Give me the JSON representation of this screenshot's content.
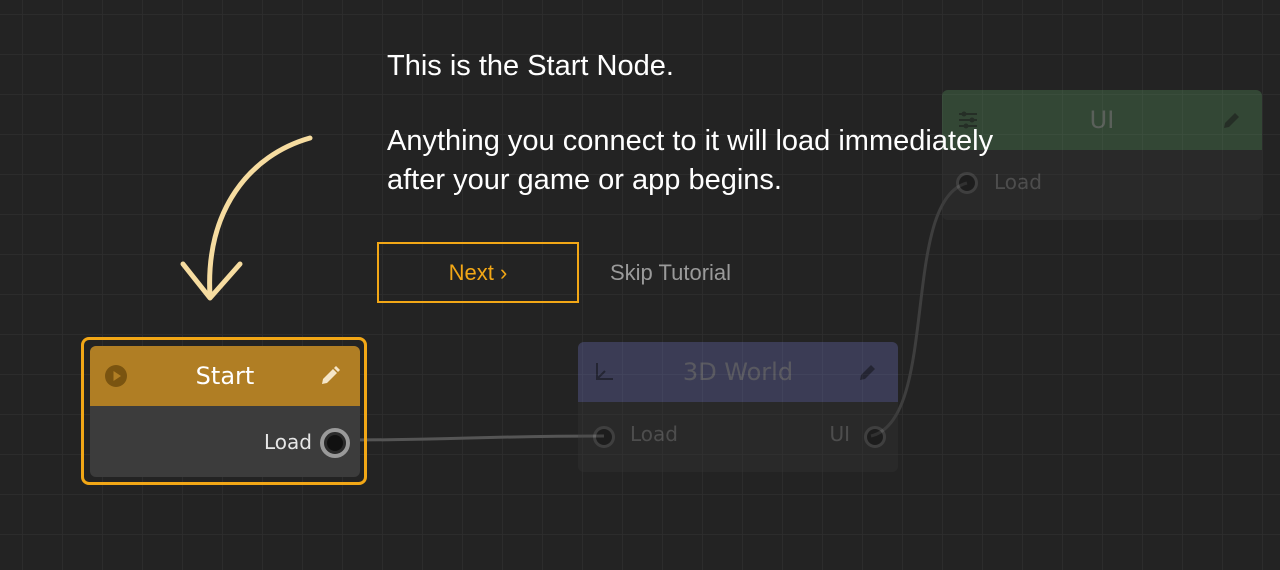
{
  "tutorial": {
    "line1": "This is the Start Node.",
    "line2": "Anything you connect to it will load immediately",
    "line3": "after your game or app begins.",
    "next_label": "Next ›",
    "skip_label": "Skip Tutorial"
  },
  "nodes": {
    "start": {
      "title": "Start",
      "output_label": "Load",
      "icon": "play-icon",
      "edit_icon": "pencil-icon",
      "color": "#b07e24"
    },
    "world": {
      "title": "3D World",
      "input_label": "Load",
      "output_label": "UI",
      "icon": "axes-icon",
      "edit_icon": "pencil-icon",
      "color": "#7a7fd6"
    },
    "ui": {
      "title": "UI",
      "input_label": "Load",
      "icon": "sliders-icon",
      "edit_icon": "pencil-icon",
      "color": "#5fa466"
    }
  },
  "colors": {
    "accent": "#f2a716",
    "background": "#232323"
  }
}
